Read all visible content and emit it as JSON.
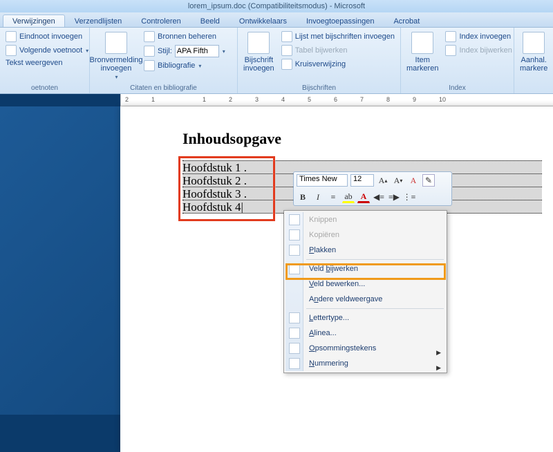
{
  "title": "lorem_ipsum.doc (Compatibiliteitsmodus) - Microsoft",
  "tabs": [
    "Verwijzingen",
    "Verzendlijsten",
    "Controleren",
    "Beeld",
    "Ontwikkelaars",
    "Invoegtoepassingen",
    "Acrobat"
  ],
  "active_tab_index": 0,
  "ribbon": {
    "group1": {
      "btn_eind": "Eindnoot invoegen",
      "btn_voet": "Volgende voetnoot",
      "btn_tekst": "Tekst weergeven",
      "label": "oetnoten"
    },
    "group2": {
      "big": "Bronvermelding invoegen",
      "bronnen": "Bronnen beheren",
      "stijl_label": "Stijl:",
      "stijl_value": "APA Fifth",
      "biblio": "Bibliografie",
      "label": "Citaten en bibliografie"
    },
    "group3": {
      "big": "Bijschrift invoegen",
      "lijst": "Lijst met bijschriften invoegen",
      "tabel": "Tabel bijwerken",
      "kruis": "Kruisverwijzing",
      "label": "Bijschriften"
    },
    "group4": {
      "big": "Item markeren",
      "index_inv": "Index invoegen",
      "index_bij": "Index bijwerken",
      "label": "Index"
    },
    "group5": {
      "big": "Aanhal. markere"
    }
  },
  "ruler_marks": [
    "2",
    "1",
    "",
    "1",
    "2",
    "3",
    "4",
    "5",
    "6",
    "7",
    "8",
    "9",
    "10"
  ],
  "document": {
    "heading": "Inhoudsopgave",
    "toc": [
      "Hoofdstuk 1",
      "Hoofdstuk 2",
      "Hoofdstuk 3",
      "Hoofdstuk 4"
    ]
  },
  "mini_toolbar": {
    "font": "Times New",
    "size": "12"
  },
  "context_menu": {
    "items": [
      {
        "label": "Knippen",
        "u": 0,
        "disabled": true,
        "icon": true
      },
      {
        "label": "Kopiëren",
        "u": 0,
        "disabled": true,
        "icon": true
      },
      {
        "label": "Plakken",
        "u": 0,
        "icon": true
      },
      {
        "sep": true
      },
      {
        "label": "Veld bijwerken",
        "u": 5,
        "icon": true
      },
      {
        "label": "Veld bewerken...",
        "u": 0
      },
      {
        "label": "Andere veldweergave",
        "u": 1
      },
      {
        "sep": true
      },
      {
        "label": "Lettertype...",
        "u": 0,
        "icon": true
      },
      {
        "label": "Alinea...",
        "u": 0,
        "icon": true
      },
      {
        "label": "Opsommingstekens",
        "u": 0,
        "icon": true,
        "sub": true
      },
      {
        "label": "Nummering",
        "u": 0,
        "icon": true,
        "sub": true
      }
    ]
  }
}
